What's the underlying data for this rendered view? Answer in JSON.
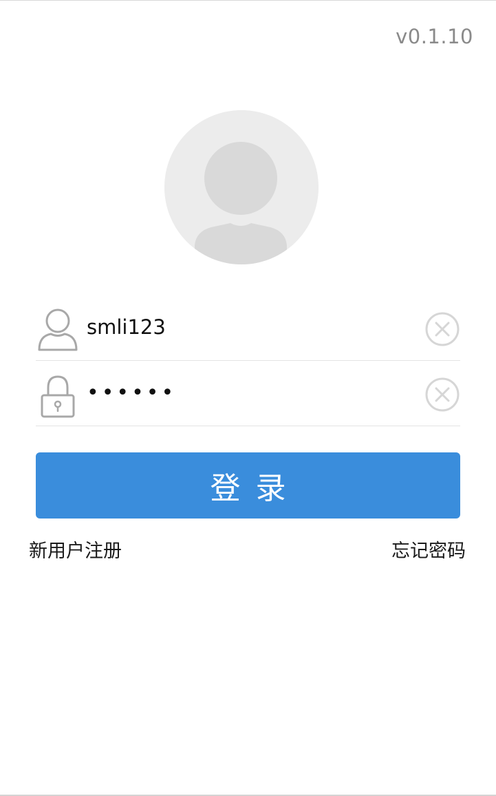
{
  "app": {
    "version": "v0.1.10"
  },
  "avatar": {
    "icon": "default-user-avatar"
  },
  "username": {
    "value": "smli123",
    "icon": "user-icon",
    "clear_icon": "clear-circle-x-icon"
  },
  "password": {
    "value": "••••••",
    "icon": "lock-icon",
    "clear_icon": "clear-circle-x-icon"
  },
  "login_button": {
    "label": "登录"
  },
  "links": {
    "register": "新用户注册",
    "forgot_password": "忘记密码"
  },
  "colors": {
    "primary": "#3a8ddc",
    "icon_gray": "#a8a8a8",
    "avatar_bg": "#ececec",
    "avatar_fg": "#d9d9d9",
    "divider": "#e3e3e3",
    "version_text": "#8a8a8a"
  }
}
